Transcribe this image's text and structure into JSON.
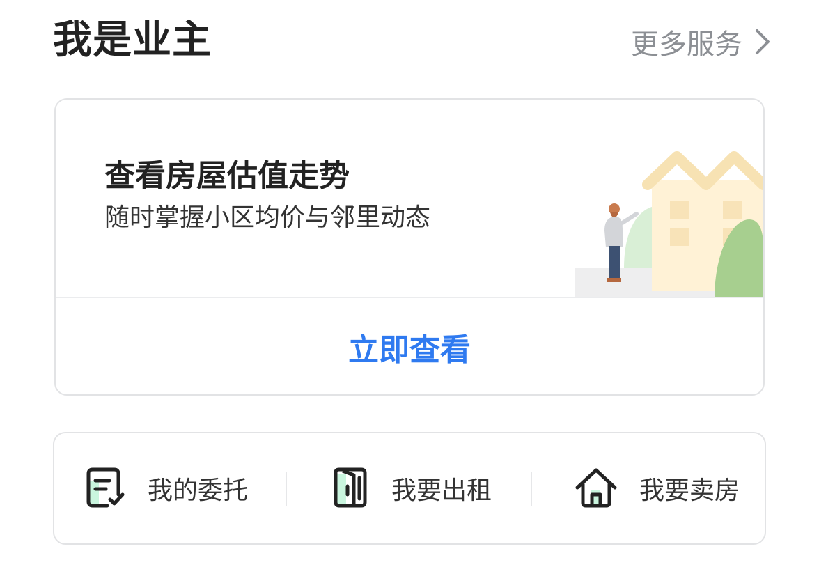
{
  "header": {
    "title": "我是业主",
    "more_label": "更多服务"
  },
  "valuation_card": {
    "title": "查看房屋估值走势",
    "subtitle": "随时掌握小区均价与邻里动态",
    "cta_label": "立即查看",
    "accent_color": "#2f7af0"
  },
  "actions": [
    {
      "label": "我的委托",
      "icon": "entrust-document-icon"
    },
    {
      "label": "我要出租",
      "icon": "door-icon"
    },
    {
      "label": "我要卖房",
      "icon": "house-icon"
    }
  ],
  "colors": {
    "icon_accent": "#c9f5de",
    "icon_stroke": "#222222"
  }
}
